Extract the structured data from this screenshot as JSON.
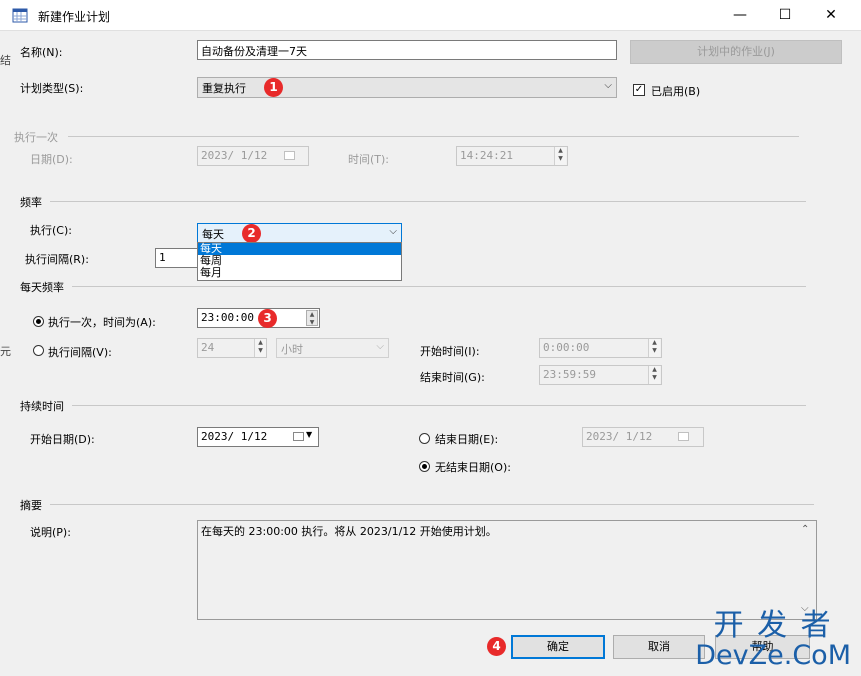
{
  "window": {
    "title": "新建作业计划",
    "minimize": "—",
    "maximize": "☐",
    "close": "✕"
  },
  "name_row": {
    "label": "名称(N):",
    "value": "自动备份及清理一7天",
    "jobs_button": "计划中的作业(J)"
  },
  "schedule_type": {
    "label": "计划类型(S):",
    "value": "重复执行",
    "enabled_label": "已启用(B)",
    "enabled": true
  },
  "once": {
    "section": "执行一次",
    "date_label": "日期(D):",
    "date_value": "2023/ 1/12",
    "time_label": "时间(T):",
    "time_value": "14:24:21"
  },
  "frequency": {
    "section": "频率",
    "run_label": "执行(C):",
    "run_value": "每天",
    "interval_label": "执行间隔(R):",
    "interval_value": "1",
    "options": [
      "每天",
      "每周",
      "每月"
    ],
    "selected_option": "每天"
  },
  "daily": {
    "section": "每天频率",
    "once_label": "执行一次，时间为(A):",
    "once_time": "23:00:00",
    "interval_label": "执行间隔(V):",
    "interval_value": "24",
    "interval_unit": "小时",
    "start_label": "开始时间(I):",
    "start_value": "0:00:00",
    "end_label": "结束时间(G):",
    "end_value": "23:59:59"
  },
  "duration": {
    "section": "持续时间",
    "start_label": "开始日期(D):",
    "start_value": "2023/ 1/12",
    "end_date_label": "结束日期(E):",
    "end_date_value": "2023/ 1/12",
    "no_end_label": "无结束日期(O):"
  },
  "summary": {
    "section": "摘要",
    "desc_label": "说明(P):",
    "desc_value": "在每天的 23:00:00 执行。将从 2023/1/12 开始使用计划。"
  },
  "buttons": {
    "ok": "确定",
    "cancel": "取消",
    "help": "帮助"
  },
  "badges": [
    "1",
    "2",
    "3",
    "4"
  ],
  "side_fragments": {
    "left1": "结",
    "left2": "元"
  },
  "watermark": {
    "line1": "开 发 者",
    "line2": "DevZe.CoM"
  },
  "colors": {
    "accent": "#0078d7",
    "badge": "#e82a2a",
    "watermark": "#1b5fa8"
  }
}
